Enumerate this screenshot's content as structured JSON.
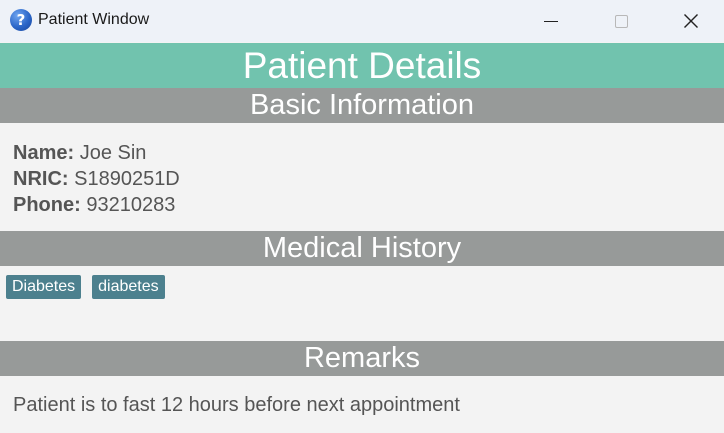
{
  "window": {
    "title": "Patient Window",
    "icon": "question-mark-icon",
    "controls": {
      "minimize_icon": "minimize-icon",
      "maximize_icon": "maximize-icon",
      "close_glyph": "✕"
    }
  },
  "header": {
    "title": "Patient Details",
    "color": "#71c3ae"
  },
  "sections": {
    "basic_info": {
      "title": "Basic Information",
      "fields": [
        {
          "label": "Name:",
          "value": "Joe Sin"
        },
        {
          "label": "NRIC:",
          "value": "S1890251D"
        },
        {
          "label": "Phone:",
          "value": "93210283"
        }
      ]
    },
    "medical_history": {
      "title": "Medical History",
      "tags": [
        "Diabetes",
        "diabetes"
      ],
      "tag_color": "#4c808e"
    },
    "remarks": {
      "title": "Remarks",
      "text": "Patient is to fast 12 hours before next appointment"
    }
  },
  "colors": {
    "section_bar": "#979a99",
    "background": "#f3f3f3",
    "text": "#555555"
  }
}
